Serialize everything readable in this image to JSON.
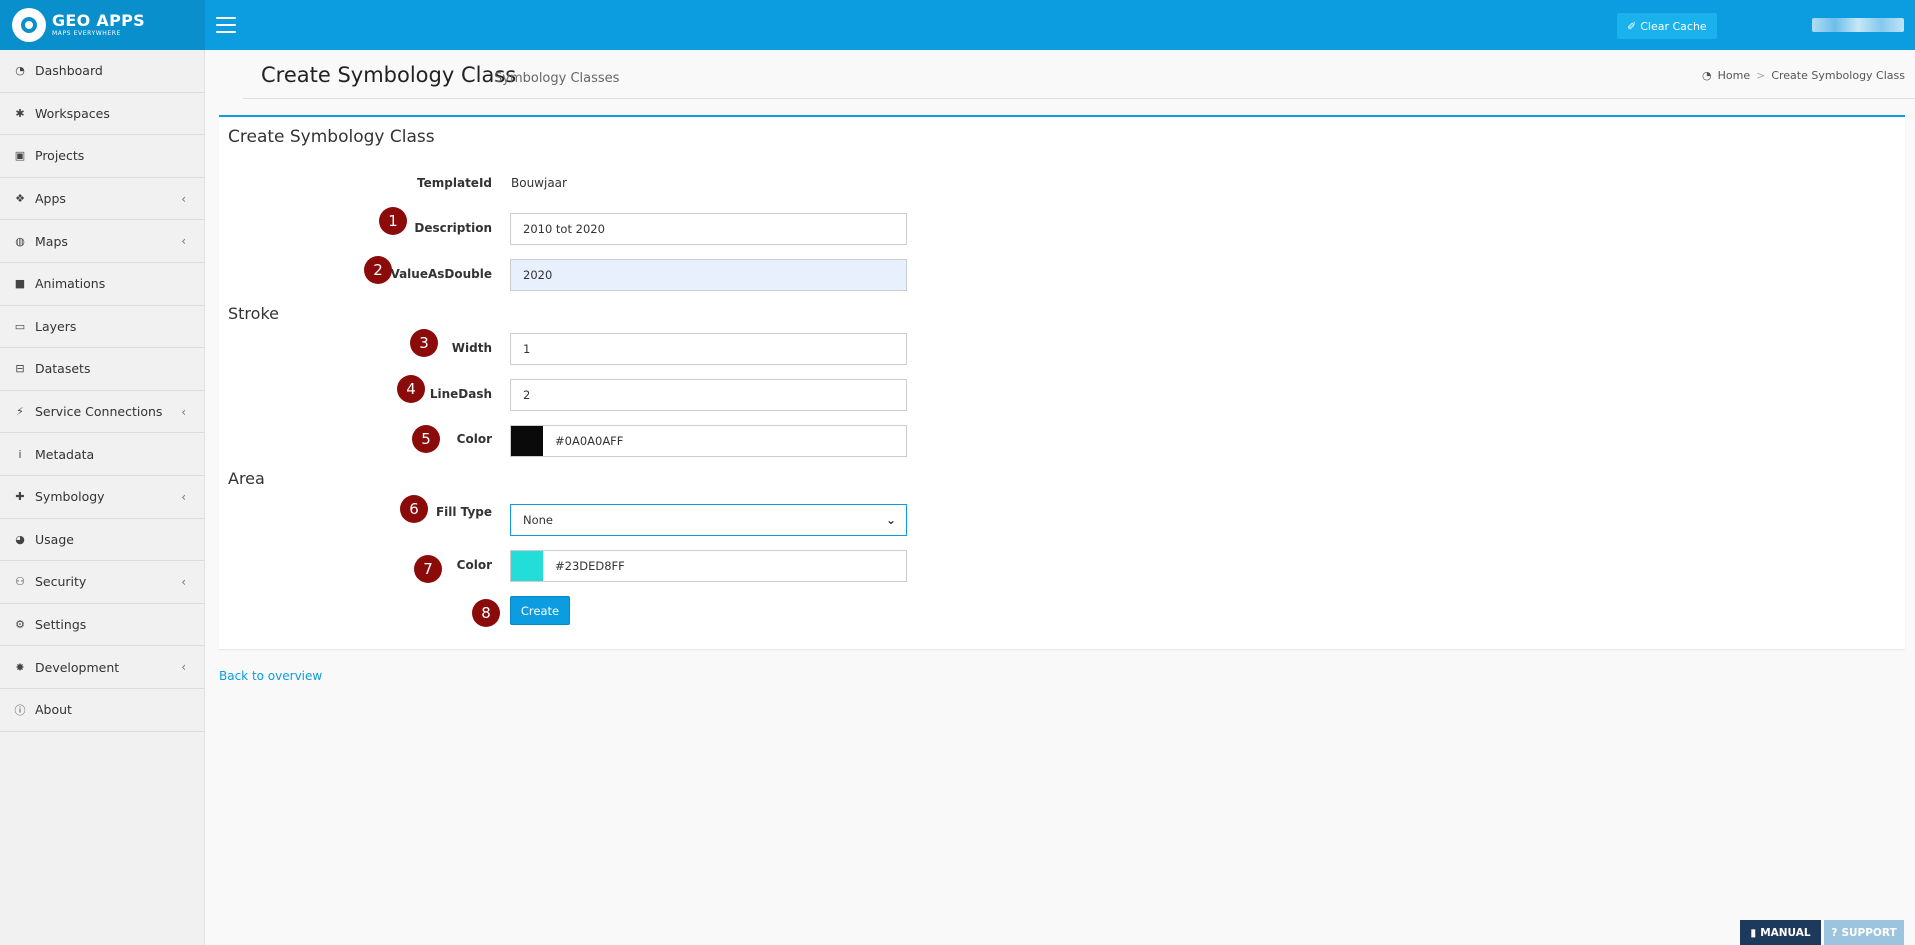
{
  "header": {
    "brand_title": "GEO APPS",
    "brand_subtitle": "MAPS EVERYWHERE",
    "clear_cache_label": "Clear Cache",
    "accent_color": "#0b9de0"
  },
  "sidebar": {
    "items": [
      {
        "label": "Dashboard",
        "icon": "dashboard-icon",
        "has_submenu": false
      },
      {
        "label": "Workspaces",
        "icon": "asterisk-icon",
        "has_submenu": false
      },
      {
        "label": "Projects",
        "icon": "briefcase-icon",
        "has_submenu": false
      },
      {
        "label": "Apps",
        "icon": "cubes-icon",
        "has_submenu": true
      },
      {
        "label": "Maps",
        "icon": "globe-icon",
        "has_submenu": true
      },
      {
        "label": "Animations",
        "icon": "video-camera-icon",
        "has_submenu": false
      },
      {
        "label": "Layers",
        "icon": "map-icon",
        "has_submenu": false
      },
      {
        "label": "Datasets",
        "icon": "hdd-icon",
        "has_submenu": false
      },
      {
        "label": "Service Connections",
        "icon": "plug-icon",
        "has_submenu": true
      },
      {
        "label": "Metadata",
        "icon": "info-icon",
        "has_submenu": false
      },
      {
        "label": "Symbology",
        "icon": "puzzle-icon",
        "has_submenu": true
      },
      {
        "label": "Usage",
        "icon": "pie-chart-icon",
        "has_submenu": false
      },
      {
        "label": "Security",
        "icon": "users-icon",
        "has_submenu": true
      },
      {
        "label": "Settings",
        "icon": "gear-icon",
        "has_submenu": false
      },
      {
        "label": "Development",
        "icon": "bug-icon",
        "has_submenu": true
      },
      {
        "label": "About",
        "icon": "info-circle-icon",
        "has_submenu": false
      }
    ]
  },
  "page": {
    "title": "Create Symbology Class",
    "subtitle": "Symbology Classes",
    "breadcrumb": {
      "home": "Home",
      "current": "Create Symbology Class"
    }
  },
  "form": {
    "box_title": "Create Symbology Class",
    "template_id_label": "TemplateId",
    "template_id_value": "Bouwjaar",
    "description_label": "Description",
    "description_value": "2010 tot 2020",
    "value_as_double_label": "ValueAsDouble",
    "value_as_double_value": "2020",
    "stroke_section": "Stroke",
    "width_label": "Width",
    "width_value": "1",
    "linedash_label": "LineDash",
    "linedash_value": "2",
    "stroke_color_label": "Color",
    "stroke_color_value": "#0A0A0AFF",
    "stroke_color_swatch": "#0a0a0a",
    "area_section": "Area",
    "fill_type_label": "Fill Type",
    "fill_type_value": "None",
    "area_color_label": "Color",
    "area_color_value": "#23DED8FF",
    "area_color_swatch": "#23ded8",
    "create_label": "Create"
  },
  "badges": [
    "1",
    "2",
    "3",
    "4",
    "5",
    "6",
    "7",
    "8"
  ],
  "back_link": "Back to overview",
  "footer": {
    "manual_label": "MANUAL",
    "support_label": "SUPPORT"
  }
}
